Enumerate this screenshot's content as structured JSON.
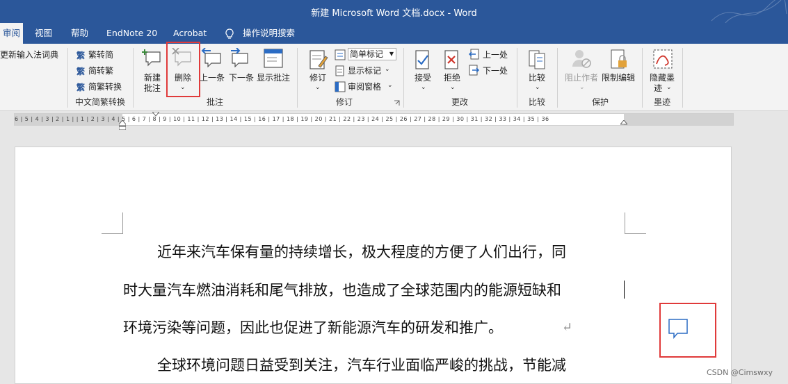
{
  "window": {
    "title": "新建 Microsoft Word 文档.docx  -  Word"
  },
  "tabs": [
    {
      "label": "审阅",
      "active": true
    },
    {
      "label": "视图"
    },
    {
      "label": "帮助"
    },
    {
      "label": "EndNote 20"
    },
    {
      "label": "Acrobat"
    },
    {
      "label": "操作说明搜索",
      "icon": "lightbulb-icon"
    }
  ],
  "ribbon": {
    "dictionary": {
      "label": "更新输入法词典"
    },
    "chinese_conversion": {
      "trad_to_simp": "繁转简",
      "simp_to_trad": "简转繁",
      "convert": "简繁转换",
      "group_label": "中文简繁转换"
    },
    "comments": {
      "new_comment": [
        "新建",
        "批注"
      ],
      "delete": "删除",
      "previous": "上一条",
      "next": "下一条",
      "show_comments": "显示批注",
      "group_label": "批注"
    },
    "tracking": {
      "track_changes": "修订",
      "markup_mode": "简单标记",
      "show_markup": "显示标记",
      "reviewing_pane": "审阅窗格",
      "group_label": "修订"
    },
    "changes": {
      "accept": "接受",
      "reject": "拒绝",
      "previous": "上一处",
      "next": "下一处",
      "group_label": "更改"
    },
    "compare": {
      "compare": "比较",
      "group_label": "比较"
    },
    "protect": {
      "block_authors": "阻止作者",
      "restrict_editing": "限制编辑",
      "group_label": "保护"
    },
    "ink": {
      "hide_ink": [
        "隐藏墨",
        "迹"
      ],
      "group_label": "墨迹"
    }
  },
  "ruler": {
    "marks": "6 | 5 | 4 | 3 | 2 | 1 |  | 1 | 2 | 3 | 4 | 5 | 6 | 7 | 8 | 9 | 10 | 11 | 12 | 13 | 14 | 15 | 16 | 17 | 18 | 19 | 20 | 21 | 22 | 23 | 24 | 25 | 26 | 27 | 28 | 29 | 30 | 31 | 32 | 33 | 34 | 35 | 36"
  },
  "document": {
    "lines": [
      "近年来汽车保有量的持续增长，极大程度的方便了人们出行，同",
      "时大量汽车燃油消耗和尾气排放，也造成了全球范围内的能源短缺和",
      "环境污染等问题，因此也促进了新能源汽车的研发和推广。",
      "全球环境问题日益受到关注，汽车行业面临严峻的挑战，节能减"
    ],
    "paragraph_mark": "↵"
  },
  "watermark": "CSDN @Cimswxy"
}
